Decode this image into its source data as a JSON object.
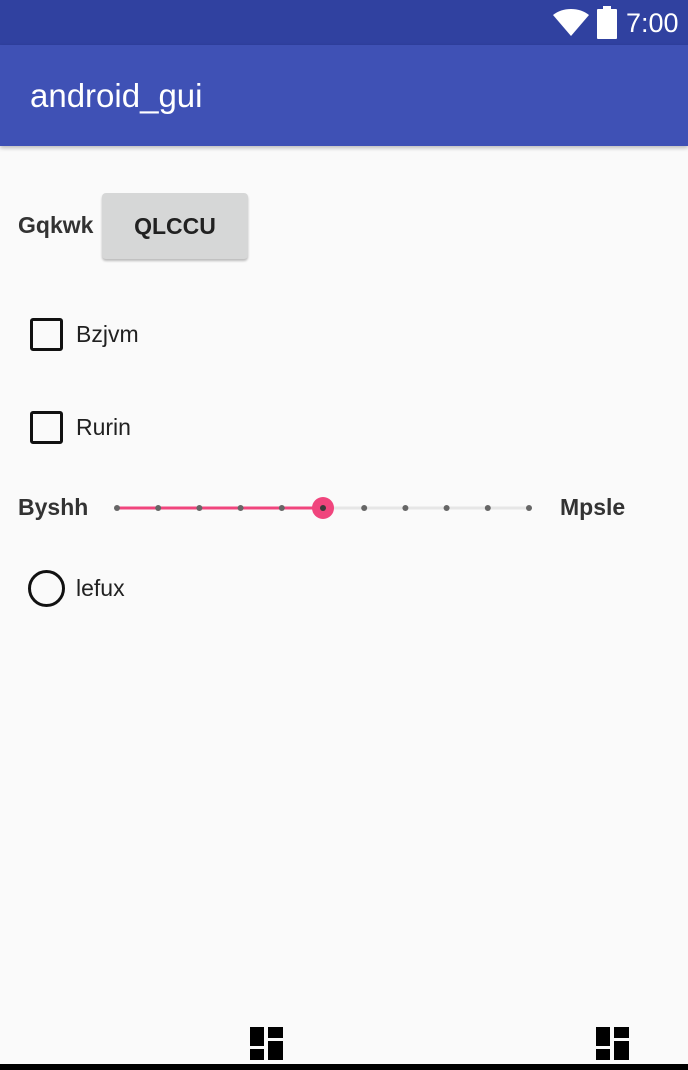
{
  "status_bar": {
    "time": "7:00",
    "icons": [
      "wifi-icon",
      "battery-icon"
    ],
    "background": "#3041a0"
  },
  "app_bar": {
    "title": "android_gui",
    "background": "#3f51b5"
  },
  "content": {
    "label_1": "Gqkwk",
    "button_label": "QLCCU",
    "checkboxes": [
      {
        "label": "Bzjvm",
        "checked": false
      },
      {
        "label": "Rurin",
        "checked": false
      }
    ],
    "seekbar": {
      "left_label": "Byshh",
      "right_label": "Mpsle",
      "min": 0,
      "max": 10,
      "value": 5,
      "accent": "#f0457d"
    },
    "radio": {
      "label": "lefux",
      "checked": false
    }
  },
  "nav": {
    "icons": [
      "dashboard-icon",
      "dashboard-icon"
    ]
  }
}
